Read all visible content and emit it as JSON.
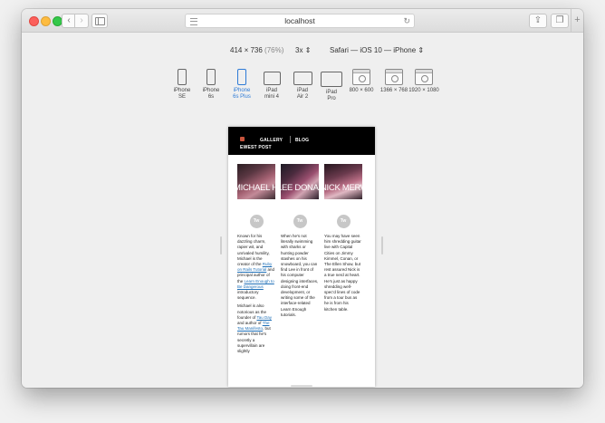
{
  "browser": {
    "address": "localhost",
    "nav_back": "‹",
    "nav_forward": "›",
    "new_tab": "+"
  },
  "responsive": {
    "size": "414 × 736",
    "size_pct": "(76%)",
    "scale": "3x",
    "agent": "Safari — iOS 10 — iPhone",
    "selected_device": "iPhone 6s Plus",
    "devices": [
      {
        "line1": "iPhone",
        "line2": "SE"
      },
      {
        "line1": "iPhone",
        "line2": "6s"
      },
      {
        "line1": "iPhone",
        "line2": "6s Plus"
      },
      {
        "line1": "iPad",
        "line2": "mini 4"
      },
      {
        "line1": "iPad",
        "line2": "Air 2"
      },
      {
        "line1": "iPad",
        "line2": "Pro"
      },
      {
        "line1": "800 × 600",
        "line2": ""
      },
      {
        "line1": "1366 × 768",
        "line2": ""
      },
      {
        "line1": "1920 × 1080",
        "line2": ""
      }
    ]
  },
  "site": {
    "nav": {
      "gallery": "GALLERY",
      "blog": "BLOG"
    },
    "title": "EWEST POST",
    "columns": [
      {
        "name": "MICHAEL HARTL",
        "twitter": "Tw",
        "bio": {
          "p1_a": "Known for his dazzling charm, rapier wit, and unrivaled humility, Michael is the creator of the ",
          "p1_link1": "Ruby on Rails Tutorial",
          "p1_b": " and principal author of the ",
          "p1_link2": "Learn Enough to Be Dangerous",
          "p1_c": " introductory sequence.",
          "p2_a": "Michael is also notorious as the founder of ",
          "p2_link1": "Tau Day",
          "p2_b": " and author of ",
          "p2_link2": "The Tau Manifesto",
          "p2_c": ", but rumors that he's secretly a supervillain are slightly"
        }
      },
      {
        "name": "LEE DONAHOE",
        "twitter": "Tw",
        "bio": {
          "p1": "When he's not literally swimming with sharks or hunting powder stashes on his snowboard, you can find Lee in front of his computer designing interfaces, doing front-end development, or writing some of the interface-related Learn Enough tutorials."
        }
      },
      {
        "name": "NICK MERWIN",
        "twitter": "Tw",
        "bio": {
          "p1": "You may have seen him shredding guitar live with Capital Cities on Jimmy Kimmel, Conan, or The Ellen Show, but rest assured Nick is a true nerd at heart. He's just as happy shredding well-spec'd lines of code from a tour bus as he is from his kitchen table."
        }
      }
    ]
  }
}
